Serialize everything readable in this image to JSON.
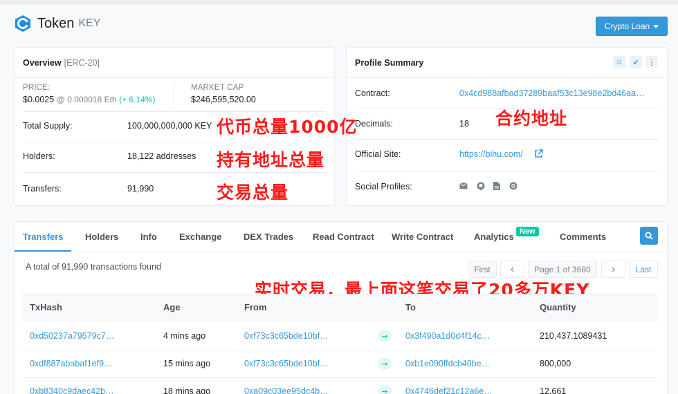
{
  "brand": {
    "name": "Token",
    "symbol": "KEY"
  },
  "header": {
    "loan_button": "Crypto Loan"
  },
  "overview": {
    "title": "Overview",
    "standard": "[ERC-20]",
    "price_label": "PRICE:",
    "price_value": "$0.0025",
    "price_eth": "@ 0.000018 Eth",
    "price_change": "(+ 6.14%)",
    "mcap_label": "MARKET CAP",
    "mcap_value": "$246,595,520.00",
    "supply_label": "Total Supply:",
    "supply_value": "100,000,000,000 KEY",
    "holders_label": "Holders:",
    "holders_value": "18,122 addresses",
    "transfers_label": "Transfers:",
    "transfers_value": "91,990"
  },
  "profile": {
    "title": "Profile Summary",
    "contract_label": "Contract:",
    "contract_value": "0x4cd988afbad37289baaf53c13e98e2bd46aa…",
    "decimals_label": "Decimals:",
    "decimals_value": "18",
    "site_label": "Official Site:",
    "site_value": "https://bihu.com/",
    "social_label": "Social Profiles:"
  },
  "annotations": {
    "supply": "代币总量1000亿",
    "holders": "持有地址总量",
    "transfers": "交易总量",
    "contract": "合约地址",
    "latest": "实时交易，最上面这笔交易了20多万KEY"
  },
  "tabs": [
    "Transfers",
    "Holders",
    "Info",
    "Exchange",
    "DEX Trades",
    "Read Contract",
    "Write Contract",
    "Analytics",
    "Comments"
  ],
  "new_badge": "New",
  "summary": "A total of 91,990 transactions found",
  "pager": {
    "first": "First",
    "prev": "‹",
    "page": "Page 1 of 3680",
    "next": "›",
    "last": "Last"
  },
  "table": {
    "headers": [
      "TxHash",
      "Age",
      "From",
      "To",
      "Quantity"
    ],
    "rows": [
      {
        "hash": "0xd50237a79579c7…",
        "age": "4 mins ago",
        "from": "0xf73c3c65bde10bf…",
        "to": "0x3f490a1d0d4f14c…",
        "qty": "210,437.1089431"
      },
      {
        "hash": "0xdf887ababaf1ef9…",
        "age": "15 mins ago",
        "from": "0xf73c3c65bde10bf…",
        "to": "0xb1e090ffdcb40be…",
        "qty": "800,000"
      },
      {
        "hash": "0xb8340c9daec42b…",
        "age": "18 mins ago",
        "from": "0xa09c03ee95dc4b…",
        "to": "0x4746def21c12a6e…",
        "qty": "12,661"
      }
    ]
  },
  "colors": {
    "accent": "#3498db",
    "positive": "#00c9a7",
    "annotation": "#ff1a1a"
  }
}
